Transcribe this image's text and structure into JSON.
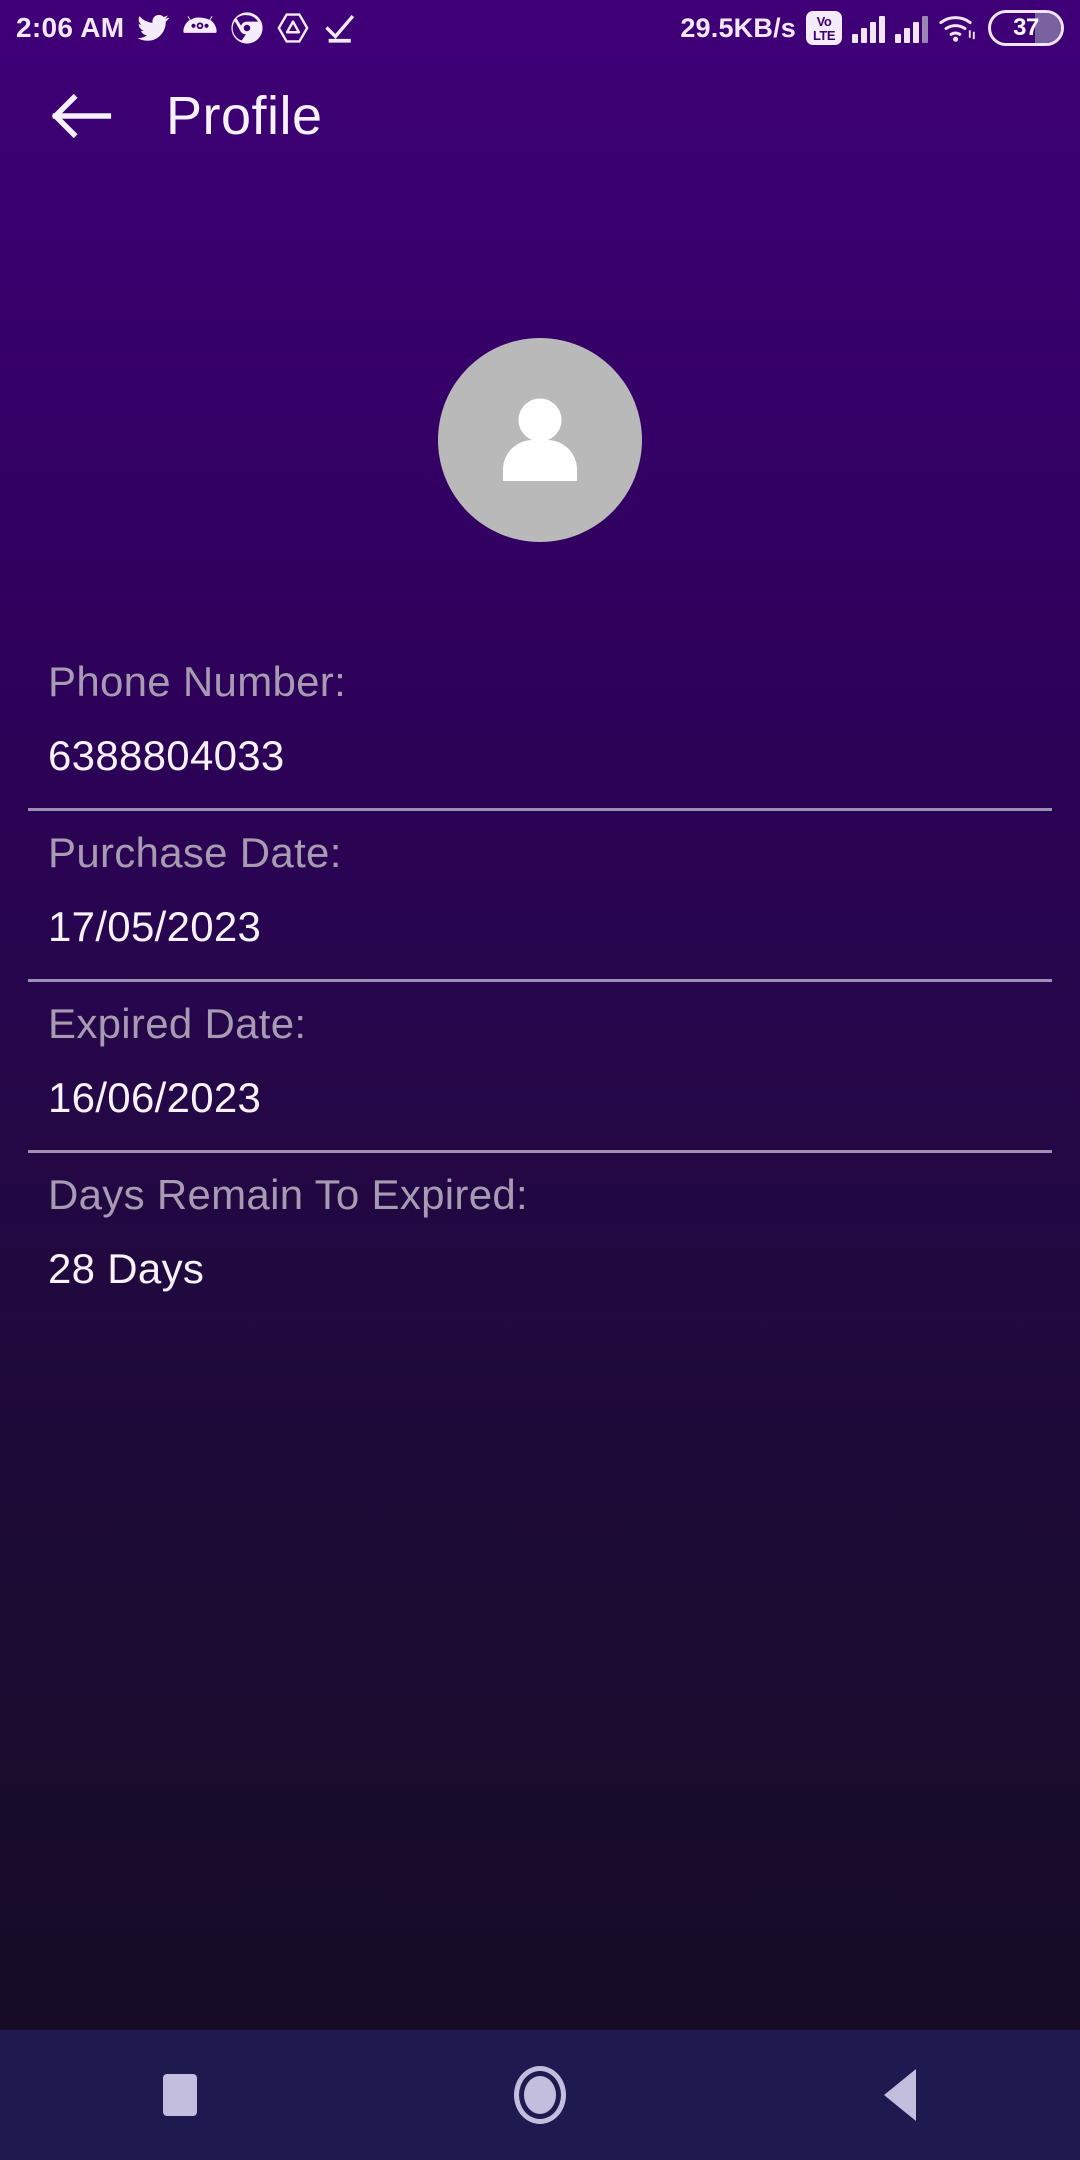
{
  "status_bar": {
    "clock": "2:06 AM",
    "network_rate": "29.5KB/s",
    "volte_top": "Vo",
    "volte_bottom": "LTE",
    "battery_level": "37",
    "icons": [
      "twitter-icon",
      "android-icon",
      "chrome-icon",
      "triangle-app-icon",
      "checkmark-icon"
    ]
  },
  "app_bar": {
    "back_label": "back-arrow",
    "title": "Profile"
  },
  "avatar": {
    "type": "person-placeholder",
    "bg_color": "#b9b9b9",
    "fg_color": "#ffffff"
  },
  "fields": [
    {
      "label": "Phone Number:",
      "value": "6388804033"
    },
    {
      "label": "Purchase Date:",
      "value": "17/05/2023"
    },
    {
      "label": "Expired Date:",
      "value": "16/06/2023"
    },
    {
      "label": "Days Remain To Expired:",
      "value": "28 Days"
    }
  ],
  "nav_bar": {
    "recents": "recents-square",
    "home": "home-circle",
    "back": "back-triangle"
  },
  "theme": {
    "gradient_top": "#3e0076",
    "gradient_bottom": "#160c26",
    "status_bar_bg": "#3f0077",
    "nav_bar_bg": "#1e1a4f",
    "label_color": "#a79bb2",
    "value_color": "#f7f2fb",
    "divider_color": "#9c8fb0"
  }
}
